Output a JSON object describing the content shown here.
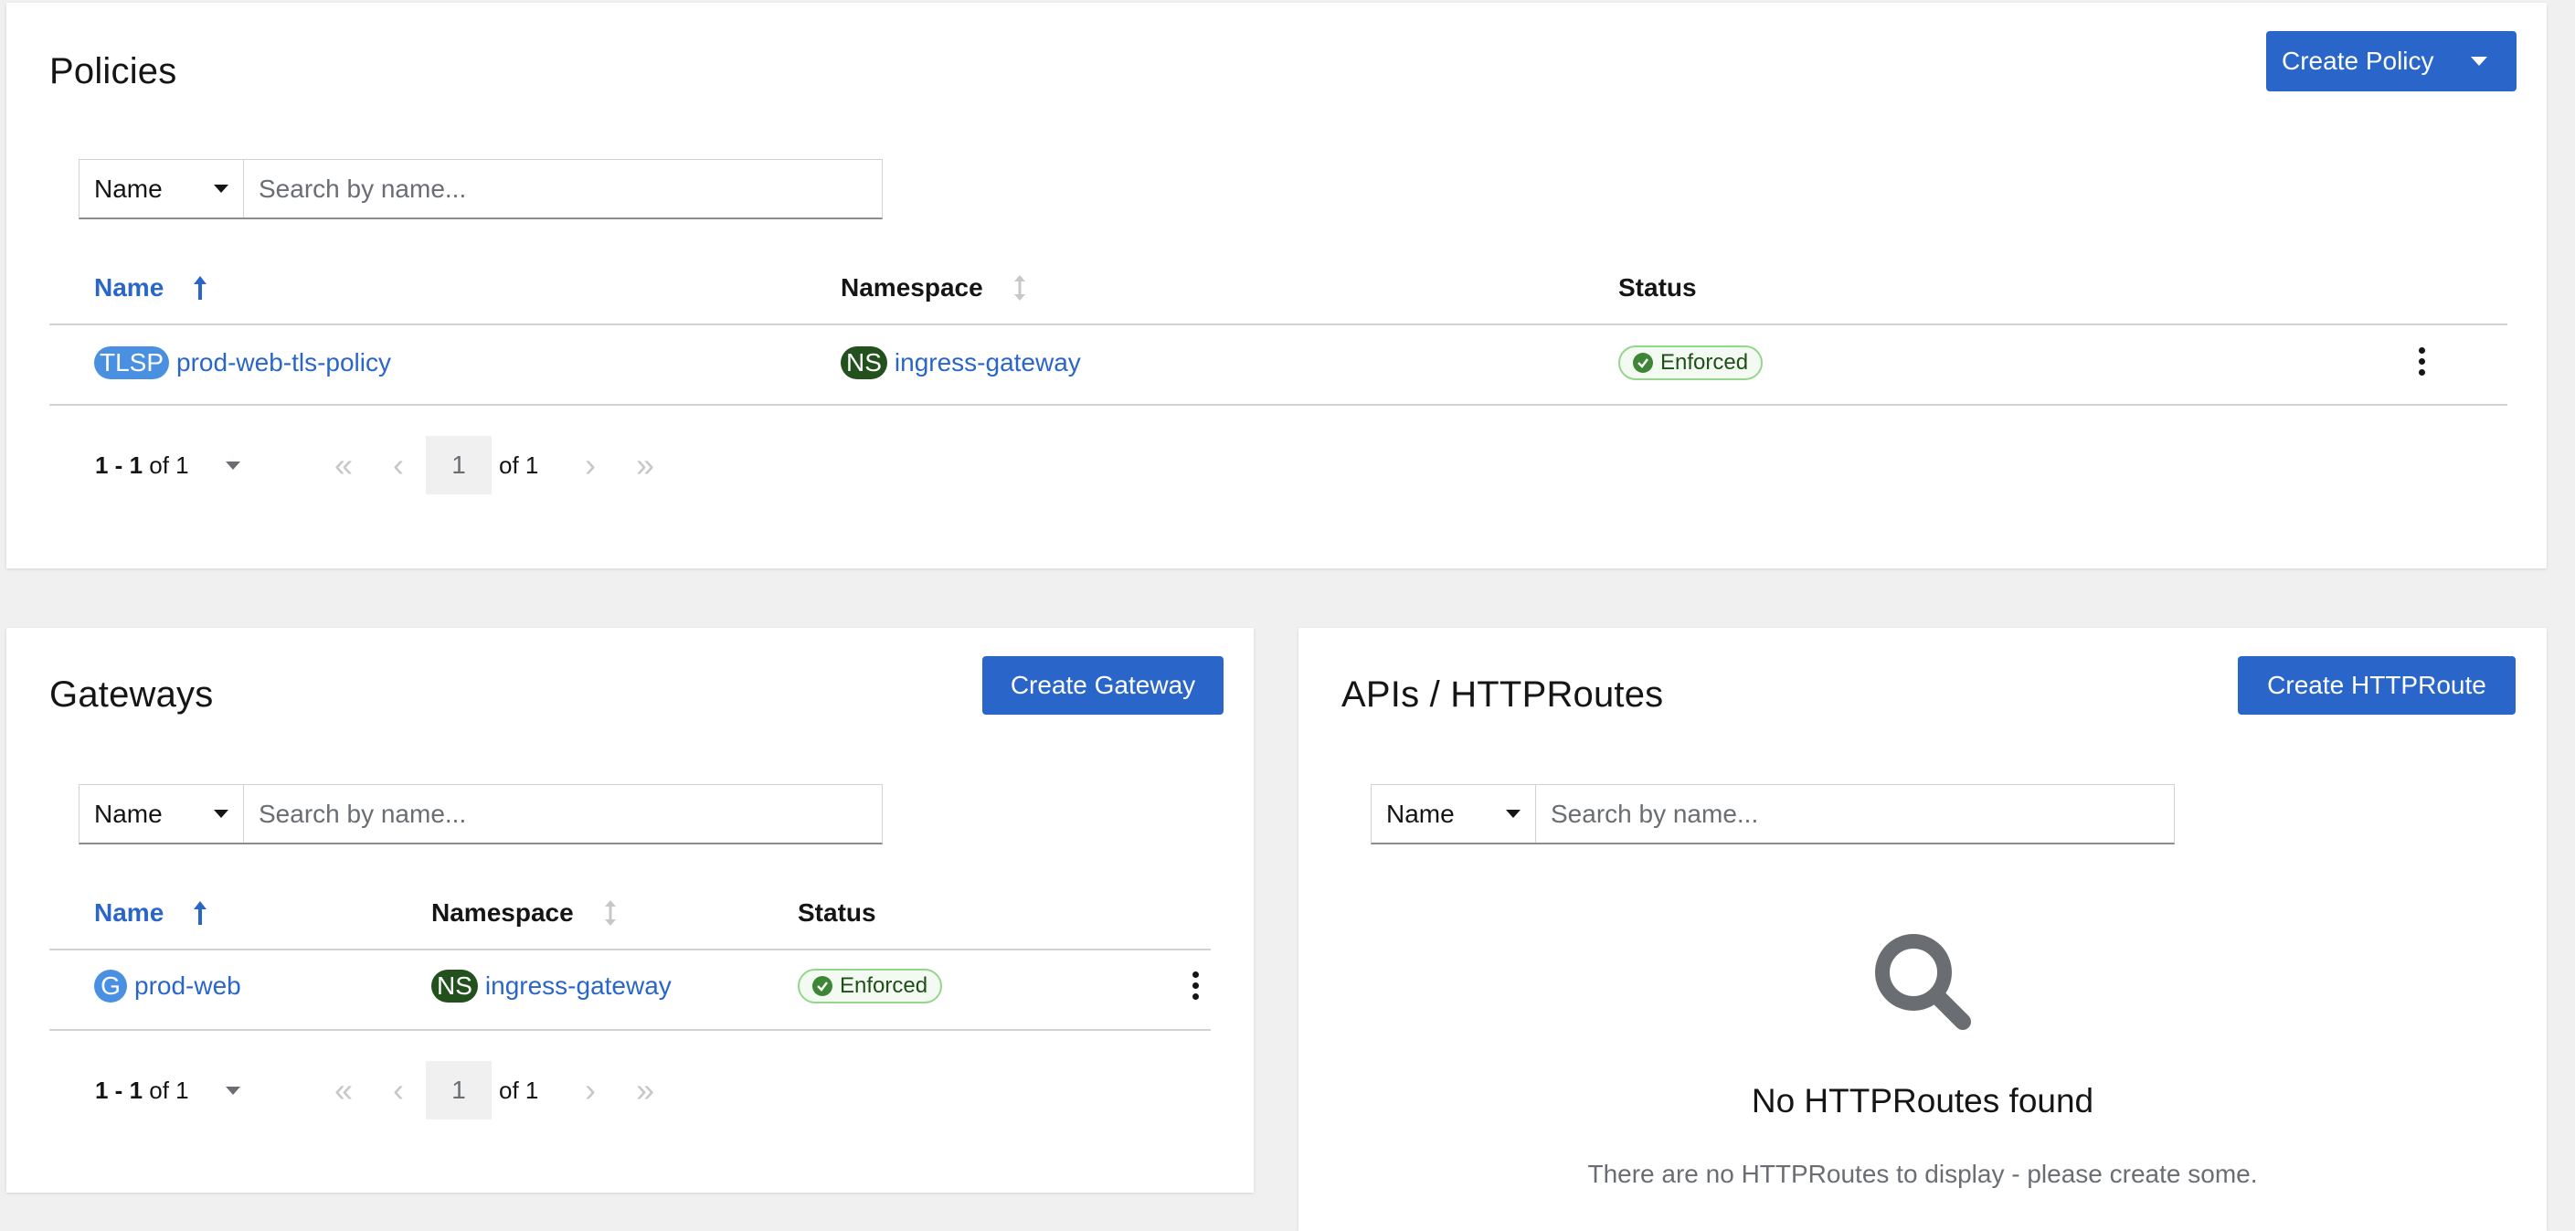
{
  "policies": {
    "title": "Policies",
    "create_button": "Create Policy",
    "filter": {
      "selected": "Name",
      "placeholder": "Search by name..."
    },
    "columns": [
      "Name",
      "Namespace",
      "Status"
    ],
    "rows": [
      {
        "kind_badge": "TLSP",
        "name": "prod-web-tls-policy",
        "ns_badge": "NS",
        "namespace": "ingress-gateway",
        "status": "Enforced"
      }
    ],
    "pagination": {
      "range": "1 - 1",
      "of_total": "of 1",
      "page": "1",
      "of_pages": "of 1"
    }
  },
  "gateways": {
    "title": "Gateways",
    "create_button": "Create Gateway",
    "filter": {
      "selected": "Name",
      "placeholder": "Search by name..."
    },
    "columns": [
      "Name",
      "Namespace",
      "Status"
    ],
    "rows": [
      {
        "kind_badge": "G",
        "name": "prod-web",
        "ns_badge": "NS",
        "namespace": "ingress-gateway",
        "status": "Enforced"
      }
    ],
    "pagination": {
      "range": "1 - 1",
      "of_total": "of 1",
      "page": "1",
      "of_pages": "of 1"
    }
  },
  "routes": {
    "title": "APIs / HTTPRoutes",
    "create_button": "Create HTTPRoute",
    "filter": {
      "selected": "Name",
      "placeholder": "Search by name..."
    },
    "empty_title": "No HTTPRoutes found",
    "empty_body": "There are no HTTPRoutes to display - please create some."
  },
  "colors": {
    "primary": "#2a66c9",
    "ns_badge": "#23511e",
    "kind_badge": "#4a90e2",
    "success": "#3e8635"
  }
}
